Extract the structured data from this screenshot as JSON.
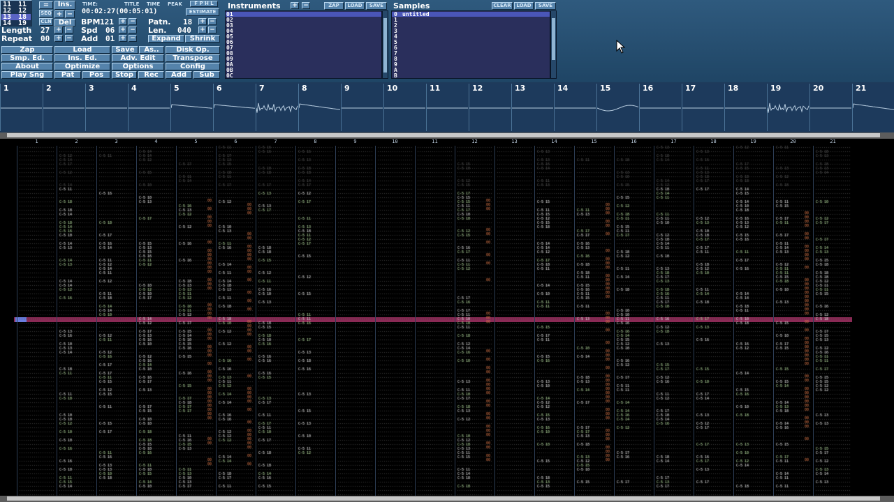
{
  "toolbar": {
    "ins_button": "Ins.",
    "seq_label": "SEQ",
    "cln_label": "CLN",
    "del_button": "Del",
    "bpm_label": "BPM",
    "bpm_value": "121",
    "spd_label": "Spd",
    "spd_value": "06",
    "add_label": "Add",
    "add_value": "01",
    "length_label": "Length",
    "length_value": "27",
    "repeat_label": "Repeat",
    "repeat_value": "00",
    "time_label": "TIME:",
    "title_label": "TITLE",
    "time_label2": "TIME",
    "peak_label": "PEAK",
    "time_value": "00:02:27(00:05:01)",
    "estimate_button": "ESTIMATE",
    "patn_label": "Patn.",
    "patn_value": "18",
    "len_label": "Len.",
    "len_value": "040",
    "expand_button": "Expand",
    "shrink_button": "Shrink",
    "orders": [
      "11",
      "12",
      "13",
      "14"
    ],
    "orders2": [
      "11",
      "12",
      "18",
      "19"
    ],
    "menu": [
      [
        "Zap",
        "Load",
        "Save",
        "As..",
        "Disk Op."
      ],
      [
        "Smp. Ed.",
        "Ins. Ed.",
        "Adv. Edit",
        "Transpose"
      ],
      [
        "About",
        "Optimize",
        "Options",
        "Config"
      ],
      [
        "Play Sng",
        "Pat",
        "Pos",
        "Stop",
        "Rec",
        "Add",
        "Sub"
      ]
    ]
  },
  "instruments": {
    "title": "Instruments",
    "zap": "ZAP",
    "load": "LOAD",
    "save": "SAVE",
    "numbers": [
      "01",
      "02",
      "03",
      "04",
      "05",
      "06",
      "07",
      "08",
      "09",
      "0A",
      "0B",
      "0C"
    ]
  },
  "samples": {
    "title": "Samples",
    "clear": "CLEAR",
    "load": "LOAD",
    "save": "SAVE",
    "first_name": "untitled",
    "numbers": [
      "0",
      "1",
      "2",
      "3",
      "4",
      "5",
      "6",
      "7",
      "8",
      "9",
      "A",
      "B"
    ]
  },
  "scopes": [
    "1",
    "2",
    "3",
    "4",
    "5",
    "6",
    "7",
    "8",
    "9",
    "10",
    "11",
    "12",
    "13",
    "14",
    "15",
    "16",
    "17",
    "18",
    "19",
    "20",
    "21"
  ],
  "pattern": {
    "channels": [
      "1",
      "2",
      "3",
      "4",
      "5",
      "6",
      "7",
      "8",
      "9",
      "10",
      "11",
      "12",
      "13",
      "14",
      "15",
      "16",
      "17",
      "18",
      "19",
      "20",
      "21"
    ]
  },
  "colors": {
    "accent": "#4a56b8",
    "highlight_row": "#8a2a55",
    "panel": "#2f5a7e"
  }
}
